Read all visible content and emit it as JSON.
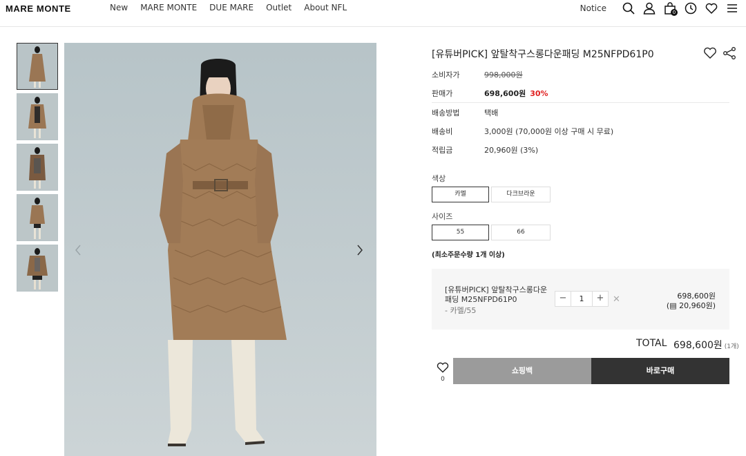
{
  "header": {
    "logo": "MARE MONTE",
    "nav": [
      "New",
      "MARE MONTE",
      "DUE MARE",
      "Outlet",
      "About NFL"
    ],
    "notice": "Notice",
    "cart_count": "0",
    "icons": [
      "search-icon",
      "user-icon",
      "cart-icon",
      "clock-icon",
      "heart-icon",
      "menu-icon"
    ]
  },
  "gallery": {
    "thumbnail_count": 5,
    "active_index": 0
  },
  "product": {
    "title": "[유튜버PICK] 앞탈착구스롱다운패딩 M25NFPD61P0",
    "rows": [
      {
        "label": "소비자가",
        "value": "998,000원"
      },
      {
        "label": "판매가",
        "value": "698,600원",
        "discount": "30%"
      },
      {
        "label": "배송방법",
        "value": "택배"
      },
      {
        "label": "배송비",
        "value": "3,000원 (70,000원 이상 구매 시 무료)"
      },
      {
        "label": "적립금",
        "value": "20,960원 (3%)"
      }
    ],
    "color_label": "색상",
    "colors": [
      "카멜",
      "다크브라운"
    ],
    "selected_color": "카멜",
    "size_label": "사이즈",
    "sizes": [
      "55",
      "66"
    ],
    "selected_size": "55",
    "min_qty_note": "(최소주문수량 1개 이상)"
  },
  "selected_item": {
    "name": "[유튜버PICK] 앞탈착구스롱다운패딩 M25NFPD61P0",
    "option": "- 카멜/55",
    "quantity": "1",
    "price": "698,600원",
    "points": "(▤ 20,960원)"
  },
  "total": {
    "label": "TOTAL",
    "value": "698,600원",
    "count": "(1개)"
  },
  "actions": {
    "wish_count": "0",
    "cart_label": "쇼핑백",
    "buy_label": "바로구매"
  },
  "colors": {
    "accent_red": "#e02020",
    "buy_button": "#333333",
    "cart_button": "#9b9b9b"
  }
}
